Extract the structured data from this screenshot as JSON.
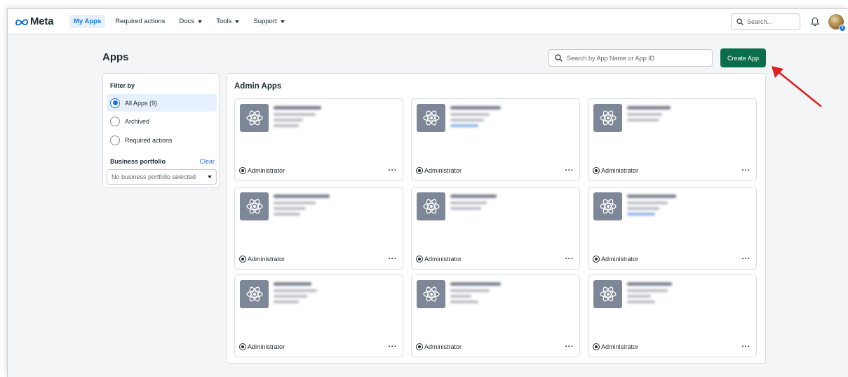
{
  "nav": {
    "logo_text": "Meta",
    "items": [
      {
        "label": "My Apps",
        "active": true,
        "caret": false
      },
      {
        "label": "Required actions",
        "active": false,
        "caret": false
      },
      {
        "label": "Docs",
        "active": false,
        "caret": true
      },
      {
        "label": "Tools",
        "active": false,
        "caret": true
      },
      {
        "label": "Support",
        "active": false,
        "caret": true
      }
    ],
    "search_placeholder": "Search..."
  },
  "page": {
    "title": "Apps",
    "app_search_placeholder": "Search by App Name or App ID",
    "create_button": "Create App"
  },
  "filter": {
    "title": "Filter by",
    "options": [
      {
        "label": "All Apps (9)",
        "selected": true
      },
      {
        "label": "Archived",
        "selected": false
      },
      {
        "label": "Required actions",
        "selected": false
      }
    ],
    "business_portfolio_label": "Business portfolio",
    "clear_label": "Clear",
    "business_portfolio_value": "No business portfolio selected"
  },
  "admin_apps": {
    "title": "Admin Apps",
    "cards": [
      {
        "role": "Administrator",
        "more": "···"
      },
      {
        "role": "Administrator",
        "more": "···"
      },
      {
        "role": "Administrator",
        "more": "···"
      },
      {
        "role": "Administrator",
        "more": "···"
      },
      {
        "role": "Administrator",
        "more": "···"
      },
      {
        "role": "Administrator",
        "more": "···"
      },
      {
        "role": "Administrator",
        "more": "···"
      },
      {
        "role": "Administrator",
        "more": "···"
      },
      {
        "role": "Administrator",
        "more": "···"
      }
    ]
  },
  "colors": {
    "brand_blue": "#1b74e4",
    "create_green": "#0a6e4a",
    "annotation_red": "#e02020",
    "app_icon_bg": "#7e8797"
  }
}
